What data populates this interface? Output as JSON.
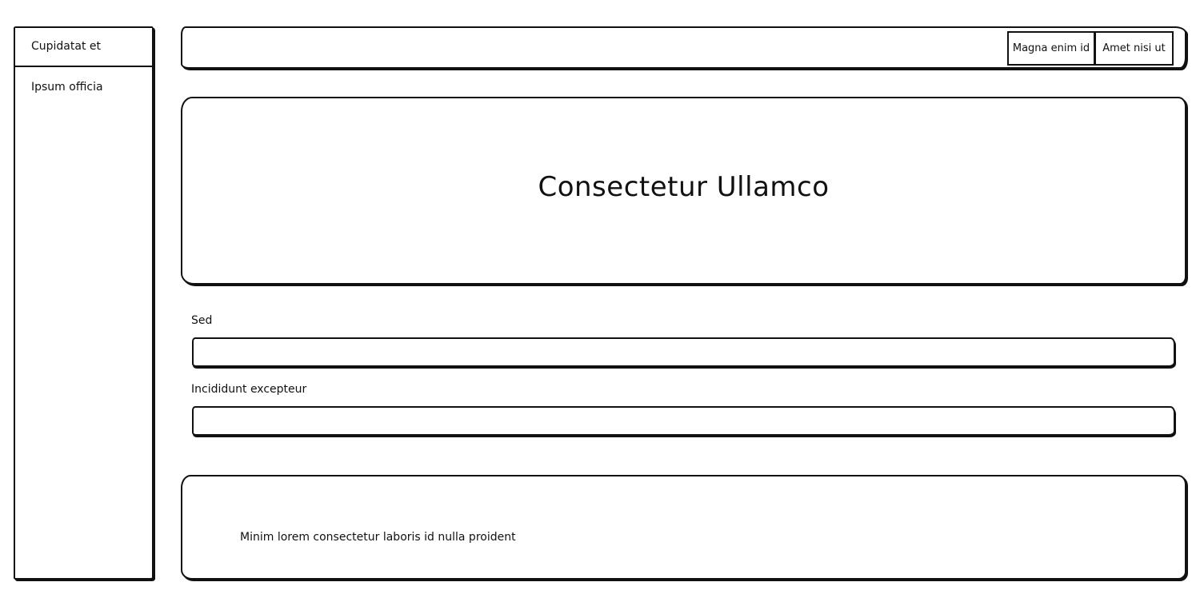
{
  "sidebar": {
    "header_label": "Cupidatat et",
    "items": [
      {
        "label": "Ipsum officia"
      }
    ]
  },
  "topbar": {
    "buttons": [
      {
        "label": "Magna enim id"
      },
      {
        "label": "Amet nisi ut"
      }
    ]
  },
  "hero": {
    "title": "Consectetur Ullamco"
  },
  "form": {
    "fields": [
      {
        "label": "Sed",
        "value": "",
        "placeholder": ""
      },
      {
        "label": "Incididunt excepteur",
        "value": "",
        "placeholder": ""
      }
    ]
  },
  "footer": {
    "text": "Minim lorem consectetur laboris id nulla proident"
  }
}
